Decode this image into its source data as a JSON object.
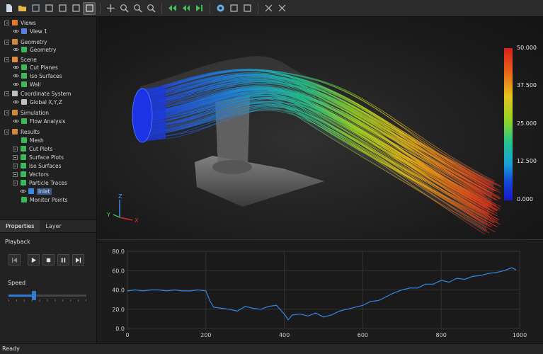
{
  "toolbar": {
    "buttons": [
      "new-file-icon",
      "open-folder-icon",
      "save-icon",
      "export-icon",
      "import-icon",
      "fit-view-icon",
      "select-icon",
      "pan-icon",
      "zoom-window-icon",
      "zoom-in-icon",
      "zoom-out-icon",
      "rewind-icon",
      "step-back-icon",
      "step-forward-icon",
      "render-icon",
      "screenshot-icon",
      "properties-icon",
      "fit-all-icon",
      "reset-view-icon"
    ],
    "active": "select-icon"
  },
  "tree": {
    "items": [
      {
        "label": "Views",
        "level": 0,
        "icon": "views-icon",
        "expander": true
      },
      {
        "label": "View 1",
        "level": 1,
        "icon": "view-icon",
        "eye": true
      },
      {
        "label": "Geometry",
        "level": 0,
        "icon": "geometry-icon",
        "expander": true
      },
      {
        "label": "Geometry",
        "level": 1,
        "icon": "geometry-item-icon",
        "eye": true
      },
      {
        "label": "Scene",
        "level": 0,
        "icon": "scene-icon",
        "expander": true
      },
      {
        "label": "Cut Planes",
        "level": 1,
        "icon": "cut-plane-icon",
        "eye": true
      },
      {
        "label": "Iso Surfaces",
        "level": 1,
        "icon": "iso-surface-icon",
        "eye": true
      },
      {
        "label": "Wall",
        "level": 1,
        "icon": "wall-icon",
        "eye": true
      },
      {
        "label": "Coordinate System",
        "level": 0,
        "icon": "coordinate-system-icon",
        "expander": true
      },
      {
        "label": "Global X,Y,Z",
        "level": 1,
        "icon": "axes-icon",
        "eye": true
      },
      {
        "label": "Simulation",
        "level": 0,
        "icon": "simulation-icon",
        "expander": true
      },
      {
        "label": "Flow Analysis",
        "level": 1,
        "icon": "flow-analysis-icon",
        "eye": true
      },
      {
        "label": "Results",
        "level": 0,
        "icon": "results-icon",
        "expander": true
      },
      {
        "label": "Mesh",
        "level": 1,
        "icon": "mesh-icon"
      },
      {
        "label": "Cut Plots",
        "level": 1,
        "icon": "cut-plot-icon",
        "expander": true
      },
      {
        "label": "Surface Plots",
        "level": 1,
        "icon": "surface-plot-icon",
        "expander": true
      },
      {
        "label": "Iso Surfaces",
        "level": 1,
        "icon": "iso-surface-result-icon",
        "expander": true
      },
      {
        "label": "Vectors",
        "level": 1,
        "icon": "vectors-icon",
        "expander": true
      },
      {
        "label": "Particle Traces",
        "level": 1,
        "icon": "particle-traces-icon",
        "expander": true
      },
      {
        "label": "Inlet",
        "level": 2,
        "icon": "inlet-icon",
        "eye": true,
        "selected": true
      },
      {
        "label": "Monitor Points",
        "level": 1,
        "icon": "monitor-points-icon"
      }
    ]
  },
  "properties": {
    "tabs": [
      "Properties",
      "Layer"
    ],
    "active_tab": "Properties",
    "playback_label": "Playback",
    "speed_label": "Speed",
    "speed_value": 0.33
  },
  "viewport": {
    "legend": {
      "labels": [
        "50.000",
        "37.500",
        "25.000",
        "12.500",
        "0.000"
      ]
    },
    "axes": {
      "x": "X",
      "y": "Y",
      "z": "Z"
    }
  },
  "chart_data": {
    "type": "line",
    "ylim": [
      0,
      80
    ],
    "xlim": [
      0,
      1000
    ],
    "y_ticks": [
      "0.0",
      "20.0",
      "40.0",
      "60.0",
      "80.0"
    ],
    "x_ticks": [
      "0",
      "200",
      "400",
      "600",
      "800",
      "1000"
    ],
    "series": [
      {
        "color": "#2f86e6",
        "x": [
          0,
          20,
          40,
          60,
          80,
          100,
          120,
          140,
          160,
          180,
          200,
          210,
          220,
          240,
          260,
          280,
          300,
          320,
          340,
          360,
          380,
          400,
          410,
          420,
          440,
          460,
          480,
          500,
          520,
          540,
          560,
          580,
          600,
          620,
          640,
          660,
          680,
          700,
          720,
          740,
          760,
          780,
          800,
          820,
          840,
          860,
          880,
          900,
          920,
          940,
          960,
          980,
          990
        ],
        "y": [
          39,
          40,
          39,
          40,
          40,
          39,
          40,
          39,
          39,
          40,
          39,
          29,
          22,
          21,
          20,
          18,
          23,
          21,
          20,
          23,
          24,
          15,
          9,
          14,
          15,
          13,
          16,
          12,
          14,
          18,
          20,
          22,
          24,
          28,
          29,
          33,
          37,
          40,
          42,
          42,
          46,
          46,
          50,
          48,
          52,
          51,
          54,
          55,
          57,
          58,
          60,
          63,
          61
        ]
      }
    ]
  },
  "status": {
    "text": "Ready"
  }
}
